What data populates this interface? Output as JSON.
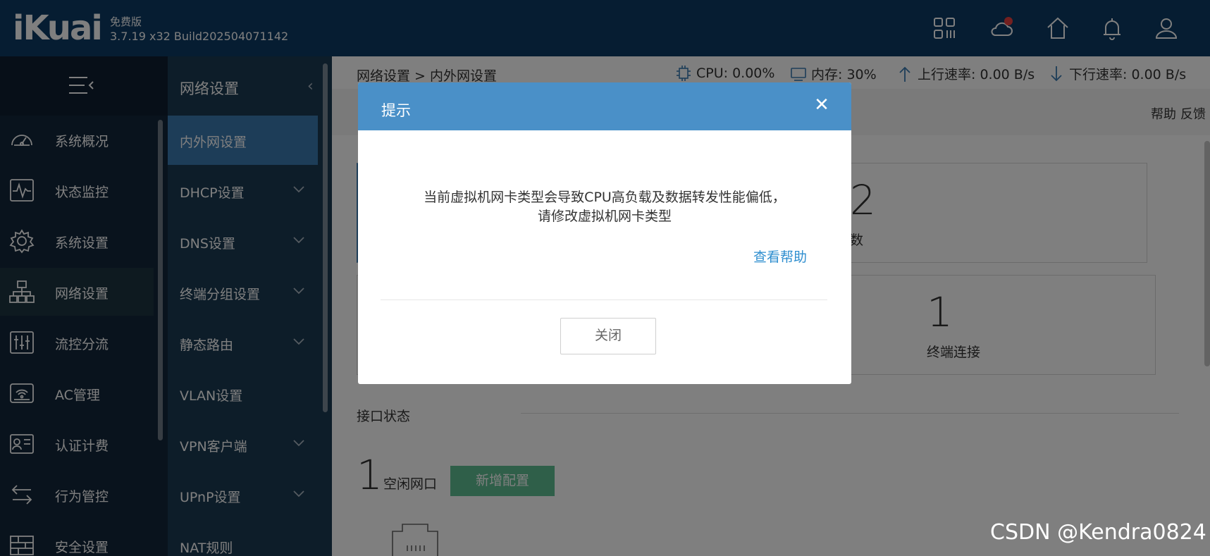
{
  "header": {
    "logo": "iKuai",
    "edition": "免费版",
    "version": "3.7.19 x32 Build202504071142",
    "icons": [
      "apps-icon",
      "cloud-icon",
      "home-icon",
      "bell-icon",
      "user-icon"
    ],
    "brand_color": "#0c3a64",
    "alert_dot_color": "#e84040"
  },
  "sidebar": {
    "items": [
      {
        "label": "系统概况",
        "icon": "dashboard-icon"
      },
      {
        "label": "状态监控",
        "icon": "monitor-icon"
      },
      {
        "label": "系统设置",
        "icon": "gear-icon"
      },
      {
        "label": "网络设置",
        "icon": "network-icon"
      },
      {
        "label": "流控分流",
        "icon": "sliders-icon"
      },
      {
        "label": "AC管理",
        "icon": "wifi-router-icon"
      },
      {
        "label": "认证计费",
        "icon": "id-card-icon"
      },
      {
        "label": "行为管控",
        "icon": "swap-icon"
      },
      {
        "label": "安全设置",
        "icon": "firewall-icon"
      }
    ],
    "active_index": 3
  },
  "subnav": {
    "title": "网络设置",
    "items": [
      {
        "label": "内外网设置",
        "expandable": false
      },
      {
        "label": "DHCP设置",
        "expandable": true
      },
      {
        "label": "DNS设置",
        "expandable": true
      },
      {
        "label": "终端分组设置",
        "expandable": true
      },
      {
        "label": "静态路由",
        "expandable": true
      },
      {
        "label": "VLAN设置",
        "expandable": false
      },
      {
        "label": "VPN客户端",
        "expandable": true
      },
      {
        "label": "UPnP设置",
        "expandable": true
      },
      {
        "label": "NAT规则",
        "expandable": false
      }
    ],
    "active_index": 0,
    "active_color": "#3a7ab0"
  },
  "statusbar": {
    "breadcrumb": "网络设置 > 内外网设置",
    "cpu": "CPU: 0.00%",
    "memory": "内存: 30%",
    "upload": "上行速率: 0.00 B/s",
    "download": "下行速率: 0.00 B/s"
  },
  "toolbar": {
    "help": "帮助",
    "feedback": "反馈"
  },
  "cards": {
    "top_right_number": "2",
    "top_right_label_partial": "数",
    "bottom_right_number": "1",
    "bottom_right_label": "终端连接"
  },
  "interfaces": {
    "section_title": "接口状态",
    "idle_count": "1",
    "idle_label": "空闲网口",
    "add_button": "新增配置",
    "add_button_color": "#5fbf92"
  },
  "dialog": {
    "title": "提示",
    "message_line1": "当前虚拟机网卡类型会导致CPU高负载及数据转发性能偏低，",
    "message_line2": "请修改虚拟机网卡类型",
    "help_link": "查看帮助",
    "close_button": "关闭",
    "header_color": "#4a90c8"
  },
  "watermark": "CSDN @Kendra0824"
}
